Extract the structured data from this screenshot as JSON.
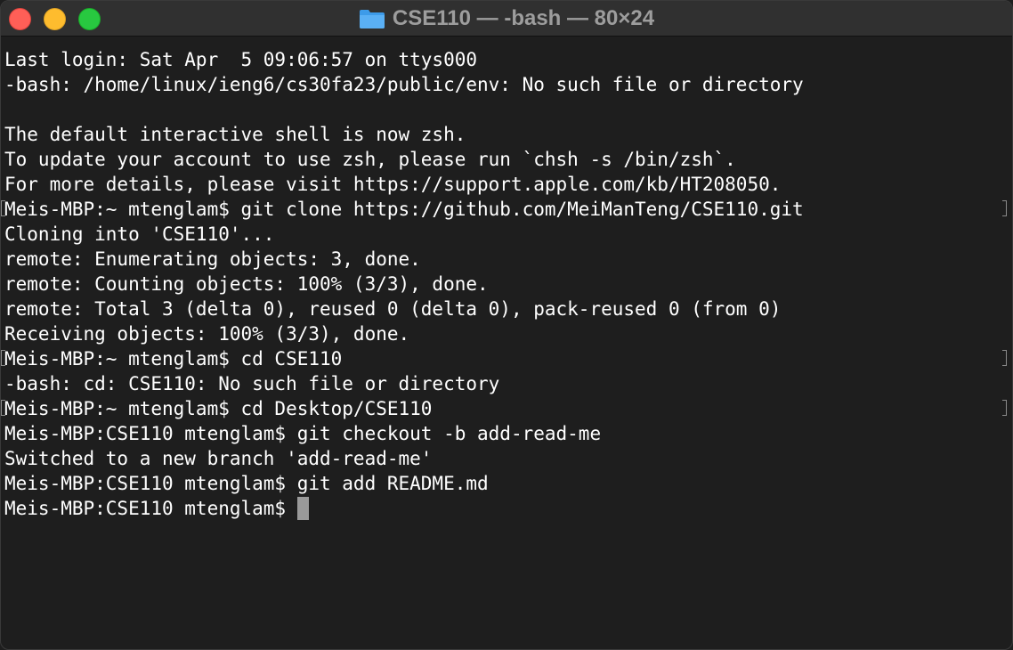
{
  "window": {
    "title": "CSE110 — -bash — 80×24",
    "title_icon": "folder-icon",
    "colors": {
      "close": "#ff5f57",
      "minimize": "#febc2e",
      "zoom": "#28c840",
      "background": "#1e1e1e",
      "text": "#ffffff"
    }
  },
  "terminal": {
    "lines": [
      {
        "text": "Last login: Sat Apr  5 09:06:57 on ttys000",
        "marked": false
      },
      {
        "text": "-bash: /home/linux/ieng6/cs30fa23/public/env: No such file or directory",
        "marked": false
      },
      {
        "text": "",
        "marked": false
      },
      {
        "text": "The default interactive shell is now zsh.",
        "marked": false
      },
      {
        "text": "To update your account to use zsh, please run `chsh -s /bin/zsh`.",
        "marked": false
      },
      {
        "text": "For more details, please visit https://support.apple.com/kb/HT208050.",
        "marked": false
      },
      {
        "text": "Meis-MBP:~ mtenglam$ git clone https://github.com/MeiManTeng/CSE110.git",
        "marked": true
      },
      {
        "text": "Cloning into 'CSE110'...",
        "marked": false
      },
      {
        "text": "remote: Enumerating objects: 3, done.",
        "marked": false
      },
      {
        "text": "remote: Counting objects: 100% (3/3), done.",
        "marked": false
      },
      {
        "text": "remote: Total 3 (delta 0), reused 0 (delta 0), pack-reused 0 (from 0)",
        "marked": false
      },
      {
        "text": "Receiving objects: 100% (3/3), done.",
        "marked": false
      },
      {
        "text": "Meis-MBP:~ mtenglam$ cd CSE110",
        "marked": true
      },
      {
        "text": "-bash: cd: CSE110: No such file or directory",
        "marked": false
      },
      {
        "text": "Meis-MBP:~ mtenglam$ cd Desktop/CSE110",
        "marked": true
      },
      {
        "text": "Meis-MBP:CSE110 mtenglam$ git checkout -b add-read-me",
        "marked": false
      },
      {
        "text": "Switched to a new branch 'add-read-me'",
        "marked": false
      },
      {
        "text": "Meis-MBP:CSE110 mtenglam$ git add README.md",
        "marked": false
      }
    ],
    "prompt": "Meis-MBP:CSE110 mtenglam$ "
  }
}
